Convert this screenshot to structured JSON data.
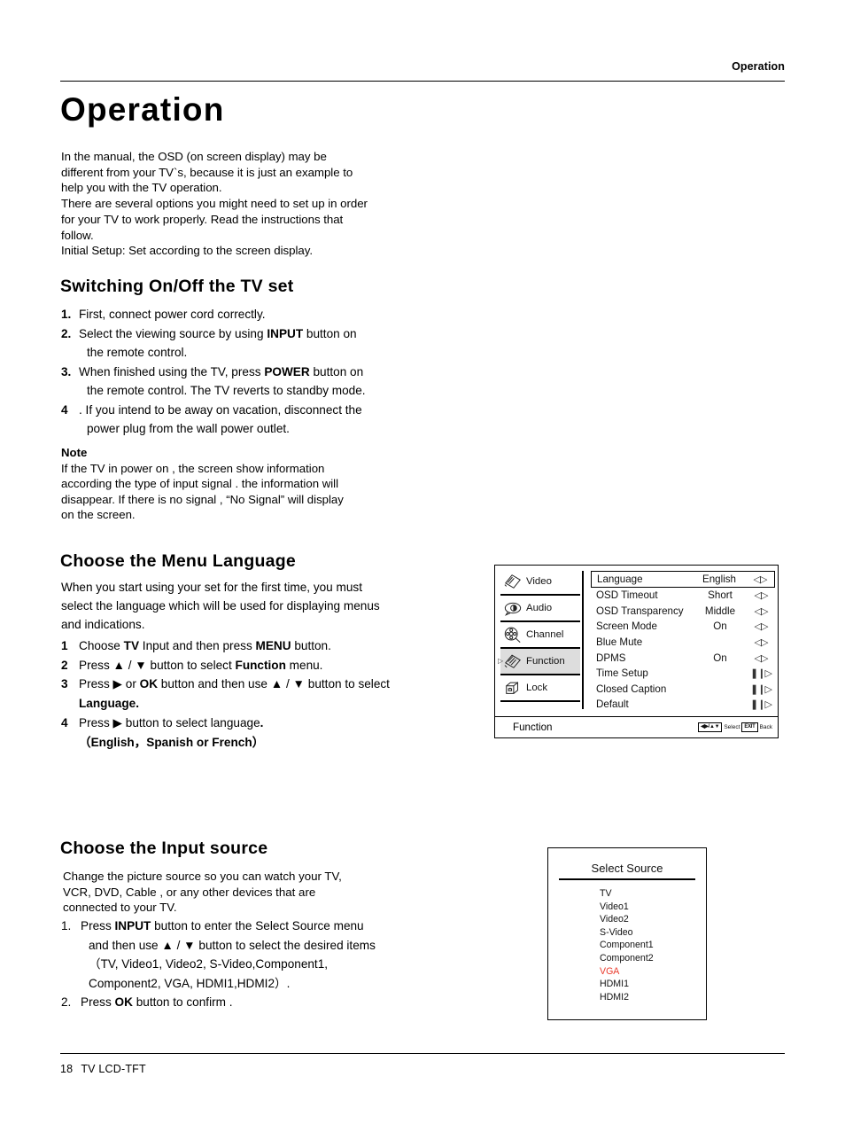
{
  "header": {
    "title": "Operation"
  },
  "chapter": {
    "title": "Operation"
  },
  "intro": {
    "lines": [
      "In the manual, the OSD   (on screen display) may be",
      "different from your TV`s,  because it is just an example to",
      "help you with the TV operation.",
      "There are several options you might need to set up in order",
      "for your TV to work properly.  Read the instructions that",
      "follow.",
      "Initial Setup: Set according to the screen display."
    ]
  },
  "switching": {
    "heading": "Switching On/Off the TV set",
    "steps": [
      {
        "num": "1.",
        "line1": "First, connect power cord correctly.",
        "line2": ""
      },
      {
        "num": "2.",
        "line1_a": "Select the viewing source by using ",
        "bold": "INPUT",
        "line1_b": " button on",
        "line2": "the remote control."
      },
      {
        "num": "3.",
        "line1_a": "When finished using the TV, press ",
        "bold": "POWER",
        "line1_b": " button on",
        "line2": "the remote control. The TV reverts to standby mode."
      },
      {
        "num": "4",
        "line1": ". If you intend to be away on vacation, disconnect the",
        "line2": "power plug from the wall power outlet."
      }
    ]
  },
  "note": {
    "title": "Note",
    "lines": [
      "If the TV in power on , the screen show information",
      "according the type of input signal . the information will",
      "disappear. If there is no signal , “No Signal”  will display",
      "on the screen."
    ]
  },
  "menu_language": {
    "heading": "Choose the Menu Language",
    "intro": [
      "When you start using your set for the first time, you must",
      "select the language which will be used for displaying menus",
      "and indications."
    ],
    "steps": [
      {
        "num": "1",
        "a": "Choose ",
        "b1": "TV",
        "c": " Input and then press ",
        "b2": "MENU",
        "d": " button."
      },
      {
        "num": "2",
        "a": "Press ▲ / ▼ button to select ",
        "b1": "Function",
        "c": " menu.",
        "b2": "",
        "d": ""
      },
      {
        "num": "3",
        "a": "Press ▶ or ",
        "b1": "OK",
        "c": " button and then use ▲ / ▼ button to select",
        "b2": "",
        "d": "",
        "sub_bold": "Language."
      },
      {
        "num": "4",
        "a": "Press ▶ button to select language",
        "b1": ".",
        "c": "",
        "b2": "",
        "d": "",
        "sub_bold2": "（English，Spanish or French）"
      }
    ]
  },
  "input_source": {
    "heading": "Choose the Input source",
    "intro": [
      "Change the picture source so you can watch your TV,",
      "VCR, DVD, Cable , or any other devices that are",
      "connected to your TV."
    ],
    "steps": [
      {
        "num": "1.",
        "a": "Press ",
        "b": "INPUT",
        "c": " button to enter the Select Source menu",
        "l2": "and then use ▲ / ▼ button to select the desired items",
        "l3": "（TV, Video1, Video2, S-Video,Component1,",
        "l4": "Component2, VGA, HDMI1,HDMI2）."
      },
      {
        "num": "2.",
        "a": "Press ",
        "b": "OK",
        "c": " button to confirm .",
        "l2": "",
        "l3": "",
        "l4": ""
      }
    ]
  },
  "osd": {
    "nav": [
      {
        "label": "Video",
        "icon": "video-icon",
        "active": false,
        "caret": ""
      },
      {
        "label": "Audio",
        "icon": "audio-icon",
        "active": false,
        "caret": ""
      },
      {
        "label": "Channel",
        "icon": "channel-icon",
        "active": false,
        "caret": ""
      },
      {
        "label": "Function",
        "icon": "function-icon",
        "active": true,
        "caret": "▷"
      },
      {
        "label": "Lock",
        "icon": "lock-icon",
        "active": false,
        "caret": ""
      }
    ],
    "rows": [
      {
        "label": "Language",
        "value": "English",
        "arrows": "◁▷",
        "type": "adjust",
        "selected": true
      },
      {
        "label": "OSD Timeout",
        "value": "Short",
        "arrows": "◁▷",
        "type": "adjust",
        "selected": false
      },
      {
        "label": "OSD Transparency",
        "value": "Middle",
        "arrows": "◁▷",
        "type": "adjust",
        "selected": false
      },
      {
        "label": "Screen Mode",
        "value": "On",
        "arrows": "◁▷",
        "type": "adjust",
        "selected": false
      },
      {
        "label": "Blue Mute",
        "value": "",
        "arrows": "◁▷",
        "type": "adjust",
        "selected": false
      },
      {
        "label": "DPMS",
        "value": "On",
        "arrows": "◁▷",
        "type": "adjust",
        "selected": false
      },
      {
        "label": "Time Setup",
        "value": "",
        "arrows": "❚❙▷",
        "type": "enter",
        "selected": false
      },
      {
        "label": "Closed Caption",
        "value": "",
        "arrows": "❚❙▷",
        "type": "enter",
        "selected": false
      },
      {
        "label": "Default",
        "value": "",
        "arrows": "❚❙▷",
        "type": "enter",
        "selected": false
      }
    ],
    "footer": {
      "title": "Function",
      "nav_key": "◀▶/▲▼",
      "nav_label": "Select",
      "exit_key": "EXIT",
      "exit_label": "Back"
    }
  },
  "select_source": {
    "title": "Select Source",
    "highlight_color": "#ea3a2c",
    "items": [
      {
        "label": "TV",
        "selected": false
      },
      {
        "label": "Video1",
        "selected": false
      },
      {
        "label": "Video2",
        "selected": false
      },
      {
        "label": "S-Video",
        "selected": false
      },
      {
        "label": "Component1",
        "selected": false
      },
      {
        "label": "Component2",
        "selected": false
      },
      {
        "label": "VGA",
        "selected": true
      },
      {
        "label": "HDMI1",
        "selected": false
      },
      {
        "label": "HDMI2",
        "selected": false
      }
    ]
  },
  "footer": {
    "page": "18",
    "doc": "TV LCD-TFT"
  }
}
